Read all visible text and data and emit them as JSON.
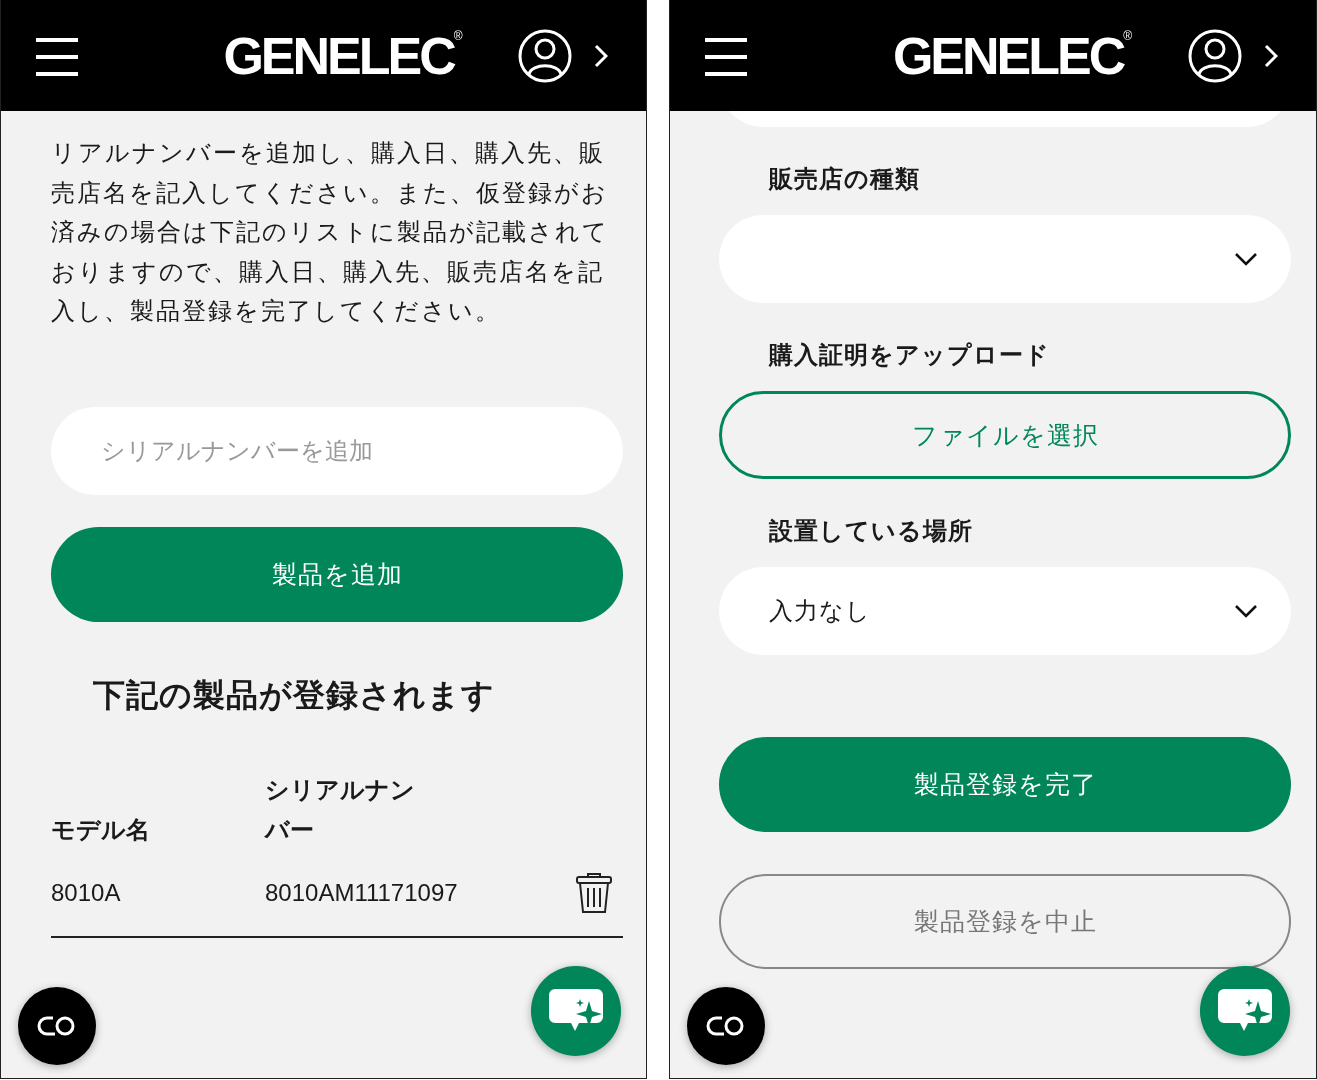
{
  "left_screen": {
    "header": {
      "logo": "GENELEC$^{®}$"
    },
    "intro": "リアルナンバーを追加し、購入日、購入先、販売店名を記入してください。また、仮登録がお済みの場合は下記のリストに製品が記載されておりますので、購入日、購入先、販売店名を記入し、製品登録を完了してください。",
    "serial_input": {
      "placeholder": "シリアルナンバーを追加"
    },
    "add_button": "製品を追加",
    "list_heading": "下記の製品が登録されます",
    "table": {
      "columns": [
        "モデル名",
        "シリアルナンバー"
      ],
      "rows": [
        {
          "model": "8010A",
          "serial": "8010AM11171097"
        }
      ]
    }
  },
  "right_screen": {
    "header": {
      "logo": "GENELEC$^{®}$"
    },
    "fields": [
      {
        "kind": "select",
        "label": "販売店の種類"
      },
      {
        "kind": "file",
        "label": "購入証明をアップロード",
        "button": "ファイルを選択"
      },
      {
        "kind": "select",
        "label": "設置している場所",
        "value": "入力なし"
      }
    ],
    "buttons": [
      {
        "kind": "primary",
        "label": "製品登録を完了"
      },
      {
        "kind": "secondary",
        "label": "製品登録を中止"
      }
    ]
  }
}
